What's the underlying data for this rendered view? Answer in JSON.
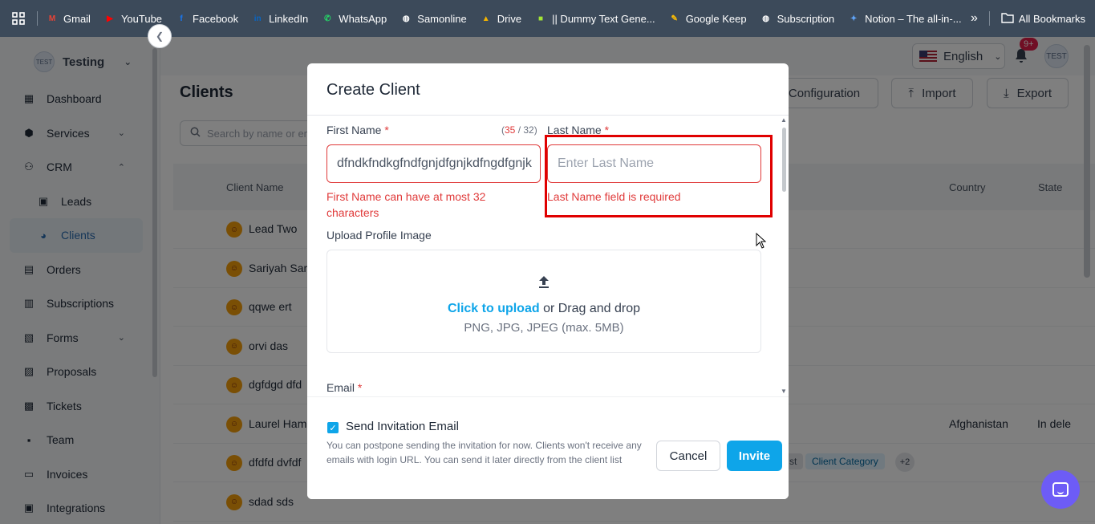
{
  "bookmarks": {
    "items": [
      {
        "label": "Gmail",
        "icon": "gmail-icon",
        "color": "#ea4335",
        "glyph": "M"
      },
      {
        "label": "YouTube",
        "icon": "youtube-icon",
        "color": "#ff0000",
        "glyph": "▶"
      },
      {
        "label": "Facebook",
        "icon": "facebook-icon",
        "color": "#1877f2",
        "glyph": "f"
      },
      {
        "label": "LinkedIn",
        "icon": "linkedin-icon",
        "color": "#0a66c2",
        "glyph": "in"
      },
      {
        "label": "WhatsApp",
        "icon": "whatsapp-icon",
        "color": "#25d366",
        "glyph": "✆"
      },
      {
        "label": "Samonline",
        "icon": "globe-icon",
        "color": "#ffffff",
        "glyph": "◍"
      },
      {
        "label": "Drive",
        "icon": "drive-icon",
        "color": "#f4b400",
        "glyph": "▲"
      },
      {
        "label": "|| Dummy Text Gene...",
        "icon": "dummy-text-icon",
        "color": "#a3e635",
        "glyph": "■"
      },
      {
        "label": "Google Keep",
        "icon": "keep-icon",
        "color": "#fbbc04",
        "glyph": "✎"
      },
      {
        "label": "Subscription",
        "icon": "globe-icon",
        "color": "#ffffff",
        "glyph": "◍"
      },
      {
        "label": "Notion – The all-in-...",
        "icon": "notion-icon",
        "color": "#60a5fa",
        "glyph": "✦"
      }
    ],
    "more": "»",
    "all_bookmarks": "All Bookmarks"
  },
  "sidebar": {
    "workspace_avatar": "TEST",
    "workspace_name": "Testing",
    "items": [
      {
        "label": "Dashboard",
        "icon": "dashboard-icon",
        "glyph": "▦",
        "chevron": ""
      },
      {
        "label": "Services",
        "icon": "box-icon",
        "glyph": "⬢",
        "chevron": "⌄"
      },
      {
        "label": "CRM",
        "icon": "crm-icon",
        "glyph": "⚇",
        "chevron": "⌃"
      },
      {
        "label": "Leads",
        "icon": "leads-icon",
        "glyph": "▣",
        "chevron": "",
        "sub": true
      },
      {
        "label": "Clients",
        "icon": "clients-icon",
        "glyph": "◕",
        "chevron": "",
        "sub": true,
        "active": true
      },
      {
        "label": "Orders",
        "icon": "orders-icon",
        "glyph": "▤",
        "chevron": ""
      },
      {
        "label": "Subscriptions",
        "icon": "subscriptions-icon",
        "glyph": "▥",
        "chevron": ""
      },
      {
        "label": "Forms",
        "icon": "forms-icon",
        "glyph": "▧",
        "chevron": "⌄"
      },
      {
        "label": "Proposals",
        "icon": "proposals-icon",
        "glyph": "▨",
        "chevron": ""
      },
      {
        "label": "Tickets",
        "icon": "tickets-icon",
        "glyph": "▩",
        "chevron": ""
      },
      {
        "label": "Team",
        "icon": "team-icon",
        "glyph": "▪",
        "chevron": ""
      },
      {
        "label": "Invoices",
        "icon": "invoices-icon",
        "glyph": "▭",
        "chevron": ""
      },
      {
        "label": "Integrations",
        "icon": "integrations-icon",
        "glyph": "▣",
        "chevron": ""
      }
    ]
  },
  "header": {
    "language": "English",
    "notification_badge": "9+",
    "user_avatar": "TEST"
  },
  "page": {
    "title": "Clients",
    "buttons": {
      "configuration": "Configuration",
      "import": "Import",
      "export": "Export"
    },
    "search_placeholder": "Search by name or em",
    "columns": {
      "client_name": "Client Name",
      "country": "Country",
      "state": "State"
    },
    "rows": [
      {
        "name": "Lead Two",
        "country": "",
        "state": ""
      },
      {
        "name": "Sariyah Sar",
        "country": "",
        "state": ""
      },
      {
        "name": "qqwe ert",
        "country": "",
        "state": ""
      },
      {
        "name": "orvi das",
        "country": "",
        "state": ""
      },
      {
        "name": "dgfdgd dfd",
        "country": "",
        "state": ""
      },
      {
        "name": "Laurel Ham",
        "country": "Afghanistan",
        "state": "In dele"
      },
      {
        "name": "dfdfd dvfdf",
        "country": "",
        "state": "",
        "tag_partial": "st",
        "tag": "Client Category",
        "more": "+2"
      },
      {
        "name": "sdad sds",
        "country": "",
        "state": ""
      }
    ]
  },
  "modal": {
    "title": "Create Client",
    "first_name": {
      "label": "First Name",
      "required": "*",
      "counter_current": "35",
      "counter_sep": " / ",
      "counter_max": "32",
      "value": "dfndkfndkgfndfgnjdfgnjkdfngdfgnjk",
      "error": "First Name can have at most 32 characters"
    },
    "last_name": {
      "label": "Last Name",
      "required": "*",
      "placeholder": "Enter Last Name",
      "error": "Last Name field is required"
    },
    "upload": {
      "label": "Upload Profile Image",
      "link": "Click to upload",
      "rest": " or Drag and drop",
      "formats": "PNG, JPG, JPEG (max. 5MB)"
    },
    "email": {
      "label": "Email",
      "required": "*"
    },
    "send_invite": {
      "label": "Send Invitation Email",
      "checked": true,
      "hint": "You can postpone sending the invitation for now. Clients won't receive any emails with login URL. You can send it later directly from the client list"
    },
    "cancel": "Cancel",
    "invite": "Invite"
  }
}
